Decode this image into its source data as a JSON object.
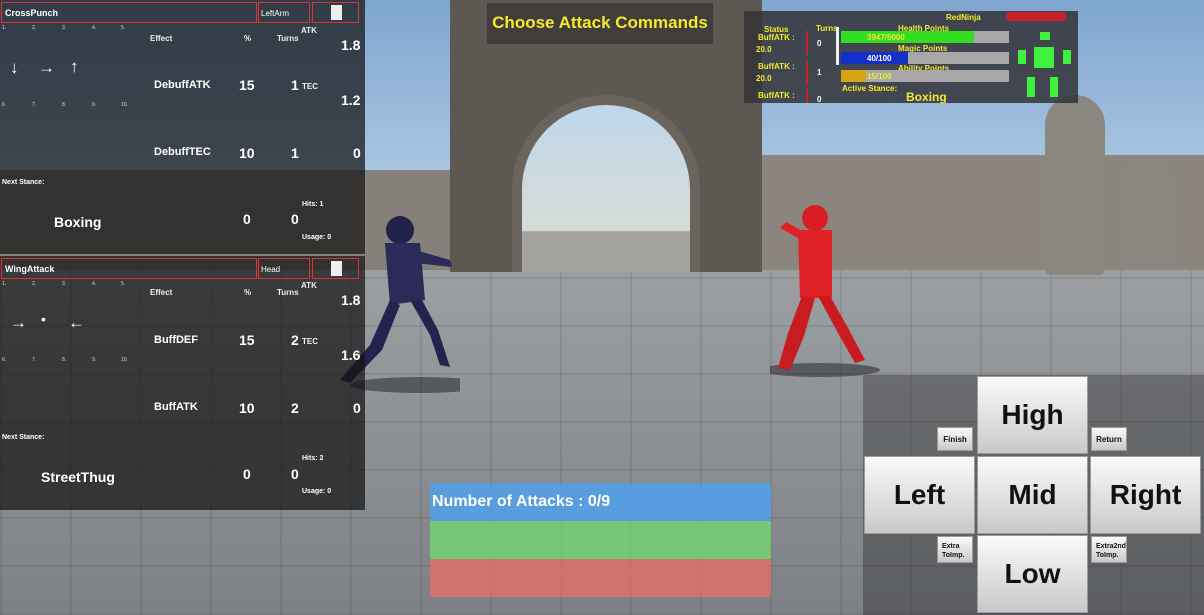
{
  "banner": {
    "title": "Choose Attack Commands"
  },
  "commands": [
    {
      "name": "CrossPunch",
      "body_part": "LeftArm",
      "slots_top": [
        "1.",
        "2.",
        "3.",
        "4.",
        "5."
      ],
      "slots_bottom": [
        "6.",
        "7.",
        "8.",
        "9.",
        "10."
      ],
      "arrows": [
        "↓",
        "→",
        "↑"
      ],
      "headers": {
        "effect": "Effect",
        "percent": "%",
        "turns": "Turns",
        "atk": "ATK"
      },
      "atk_value": "1.8",
      "tec_label": "TEC",
      "tec_value": "1.2",
      "effects": [
        {
          "name": "DebuffATK",
          "percent": "15",
          "turns": "1"
        },
        {
          "name": "DebuffTEC",
          "percent": "10",
          "turns": "1"
        }
      ],
      "third_value": "0",
      "next_stance_label": "Next Stance:",
      "next_stance": "Boxing",
      "stance_percent": "0",
      "stance_turns": "0",
      "hits": "Hits: 1",
      "usage": "Usage: 0"
    },
    {
      "name": "WingAttack",
      "body_part": "Head",
      "slots_top": [
        "1.",
        "2.",
        "3.",
        "4.",
        "5."
      ],
      "slots_bottom": [
        "6.",
        "7.",
        "8.",
        "9.",
        "10."
      ],
      "arrows": [
        "→",
        "•",
        "←"
      ],
      "headers": {
        "effect": "Effect",
        "percent": "%",
        "turns": "Turns",
        "atk": "ATK"
      },
      "atk_value": "1.8",
      "tec_label": "TEC",
      "tec_value": "1.6",
      "effects": [
        {
          "name": "BuffDEF",
          "percent": "15",
          "turns": "2"
        },
        {
          "name": "BuffATK",
          "percent": "10",
          "turns": "2"
        }
      ],
      "third_value": "0",
      "next_stance_label": "Next Stance:",
      "next_stance": "StreetThug",
      "stance_percent": "0",
      "stance_turns": "0",
      "hits": "Hits: 2",
      "usage": "Usage: 0"
    }
  ],
  "status": {
    "character": "RedNinja",
    "status_label": "Status",
    "turns_label": "Turns",
    "buffs": [
      {
        "name": "BuffATK :",
        "value": "20.0",
        "turns": "0"
      },
      {
        "name": "BuffATK :",
        "value": "20.0",
        "turns": "1"
      },
      {
        "name": "BuffATK :",
        "value": "",
        "turns": "0"
      }
    ],
    "health_label": "Health Points",
    "health_text": "3947/5000",
    "health_fraction": 0.79,
    "magic_label": "Magic Points",
    "magic_text": "40/100",
    "magic_fraction": 0.4,
    "ability_label": "Ability Points",
    "ability_text": "15/100",
    "ability_fraction": 0.15,
    "active_stance_label": "Active Stance:",
    "active_stance": "Boxing",
    "colors": {
      "health": "#33dd22",
      "magic": "#1430c8",
      "ability": "#d8a416",
      "label": "#f4ea2e"
    }
  },
  "attacks": {
    "label": "Number of Attacks : 0/9"
  },
  "dpad": {
    "high": "High",
    "left": "Left",
    "mid": "Mid",
    "right": "Right",
    "low": "Low",
    "finish": "Finish",
    "return": "Return",
    "extra_1": "Extra\nToImp.",
    "extra_2": "Extra2nd\nToImp."
  }
}
